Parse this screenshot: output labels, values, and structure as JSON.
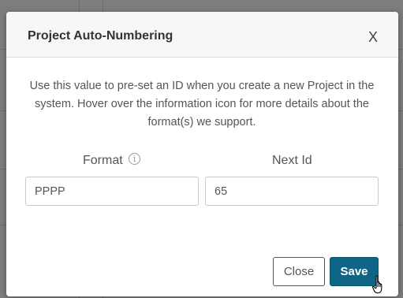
{
  "modal": {
    "title": "Project Auto-Numbering",
    "close_glyph": "X",
    "description": "Use this value to pre-set an ID when you create a new Project in the system. Hover over the information icon for more details about the format(s) we support.",
    "format_label": "Format",
    "info_icon_glyph": "i",
    "format_value": "PPPP",
    "next_id_label": "Next Id",
    "next_id_value": "65",
    "close_button": "Close",
    "save_button": "Save"
  },
  "colors": {
    "overlay": "#7d7d7d",
    "header_bg": "#f7f7f7",
    "save_button_bg": "#0f6585",
    "text": "#555555"
  },
  "icons": {
    "info": "info-circle-icon",
    "close": "close-icon",
    "cursor": "hand-pointer-icon"
  }
}
